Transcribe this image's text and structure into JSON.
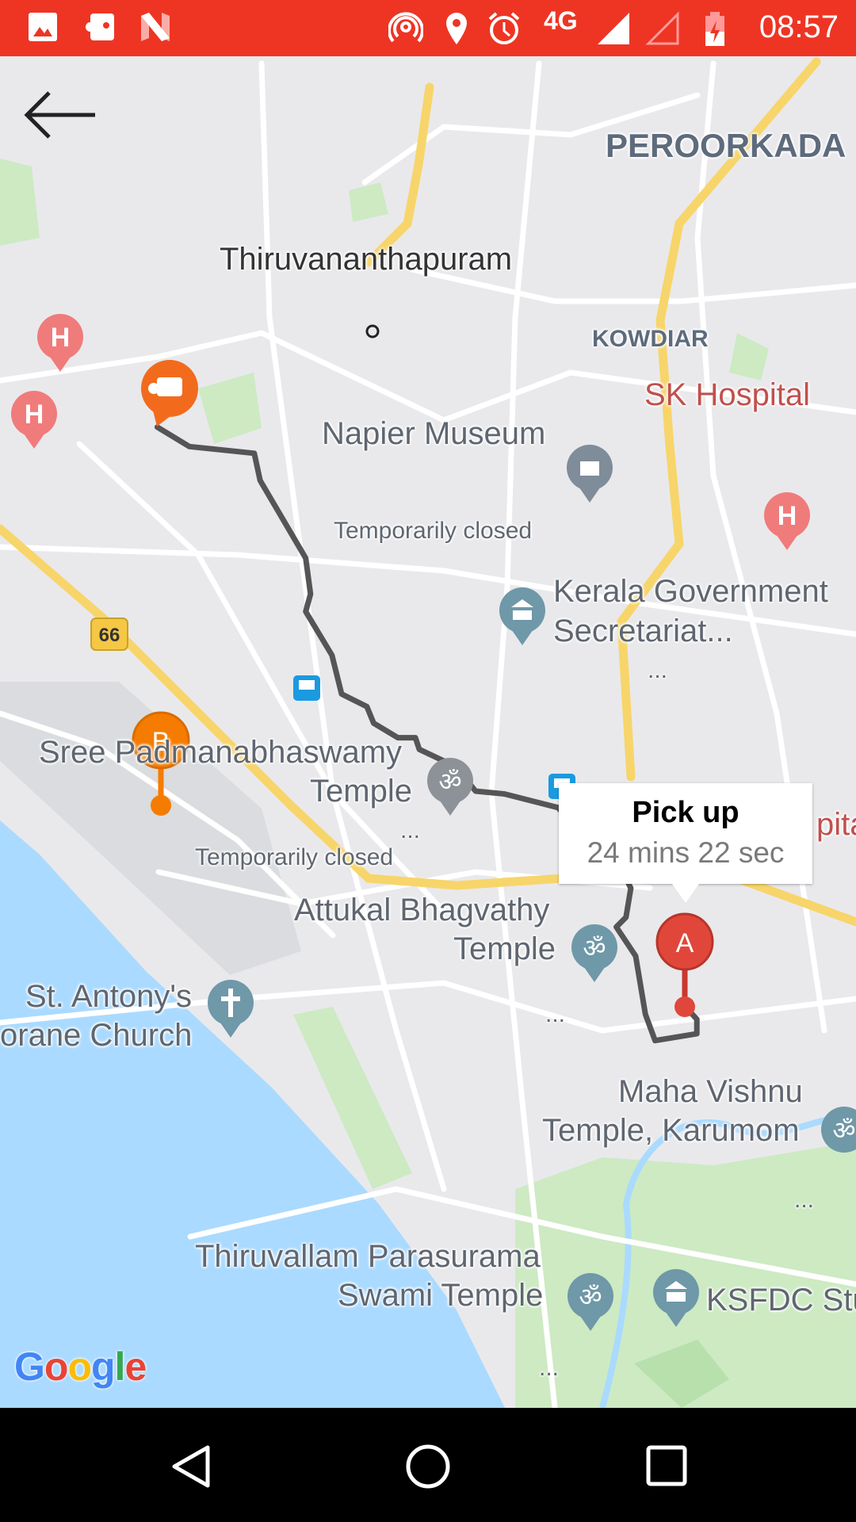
{
  "status_bar": {
    "time": "08:57",
    "network": "4G",
    "left_icons": [
      "gallery-icon",
      "app-notification-icon",
      "n-icon"
    ],
    "right_icons": [
      "hotspot-icon",
      "location-icon",
      "alarm-icon",
      "signal-icon",
      "signal-empty-icon",
      "battery-charging-icon"
    ],
    "color": "#ee3524"
  },
  "map": {
    "labels": {
      "peroorkada": "PEROORKADA",
      "city": "Thiruvananthapuram",
      "kowdiar": "KOWDIAR",
      "sk_hospital": "SK Hospital",
      "napier": "Napier Museum",
      "temp_closed_1": "Temporarily closed",
      "secretariat_1": "Kerala Government",
      "secretariat_2": "Secretariat...",
      "padmanabha_1": "Sree Padmanabhaswamy",
      "padmanabha_2": "Temple",
      "temp_closed_2": "Temporarily closed",
      "attukal_1": "Attukal Bhagvathy",
      "attukal_2": "Temple",
      "antony_1": "St. Antony's",
      "antony_2": "orane Church",
      "vishnu_1": "Maha Vishnu",
      "vishnu_2": "Temple, Karumom",
      "thiruvallam_1": "Thiruvallam Parasurama",
      "thiruvallam_2": "Swami Temple",
      "ksfdc": "KSFDC Stu",
      "hospital_partial": "pital",
      "highway": "66",
      "ellipsis": "..."
    },
    "markers": {
      "a_label": "A",
      "b_label": "B",
      "a_color": "#e0473a",
      "b_color": "#f57c00",
      "vehicle_color": "#f26b1d"
    },
    "route_color": "#555555",
    "tooltip": {
      "title": "Pick up",
      "eta": "24 mins 22 sec"
    },
    "logo": "Google"
  },
  "nav_bar": {
    "buttons": [
      "back",
      "home",
      "recents"
    ]
  }
}
